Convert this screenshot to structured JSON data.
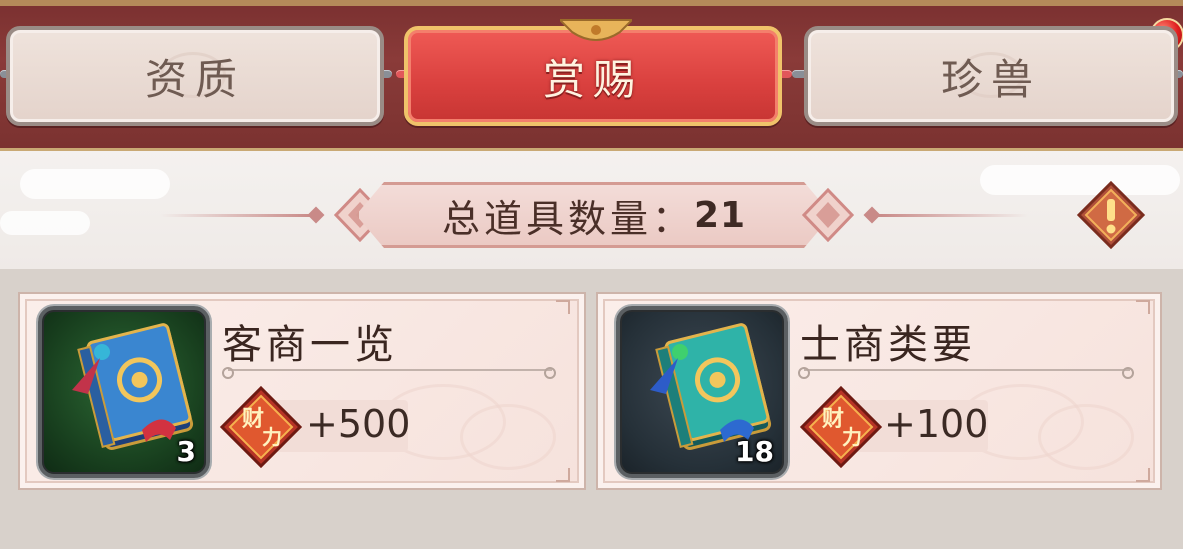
{
  "tabs": [
    {
      "label": "资质",
      "active": false
    },
    {
      "label": "赏赐",
      "active": true
    },
    {
      "label": "珍兽",
      "active": false
    }
  ],
  "summary": {
    "label": "总道具数量：",
    "count": "21"
  },
  "items": [
    {
      "name": "客商一览",
      "quantity": "3",
      "reward_badge": "财力",
      "reward_value": "+500",
      "icon_name": "green-book-icon"
    },
    {
      "name": "士商类要",
      "quantity": "18",
      "reward_badge": "财力",
      "reward_value": "+100",
      "icon_name": "teal-book-icon"
    }
  ],
  "colors": {
    "active_tab": "#d9403e",
    "topbar": "#8a3b39",
    "notification_dot": "#e01f1f"
  }
}
